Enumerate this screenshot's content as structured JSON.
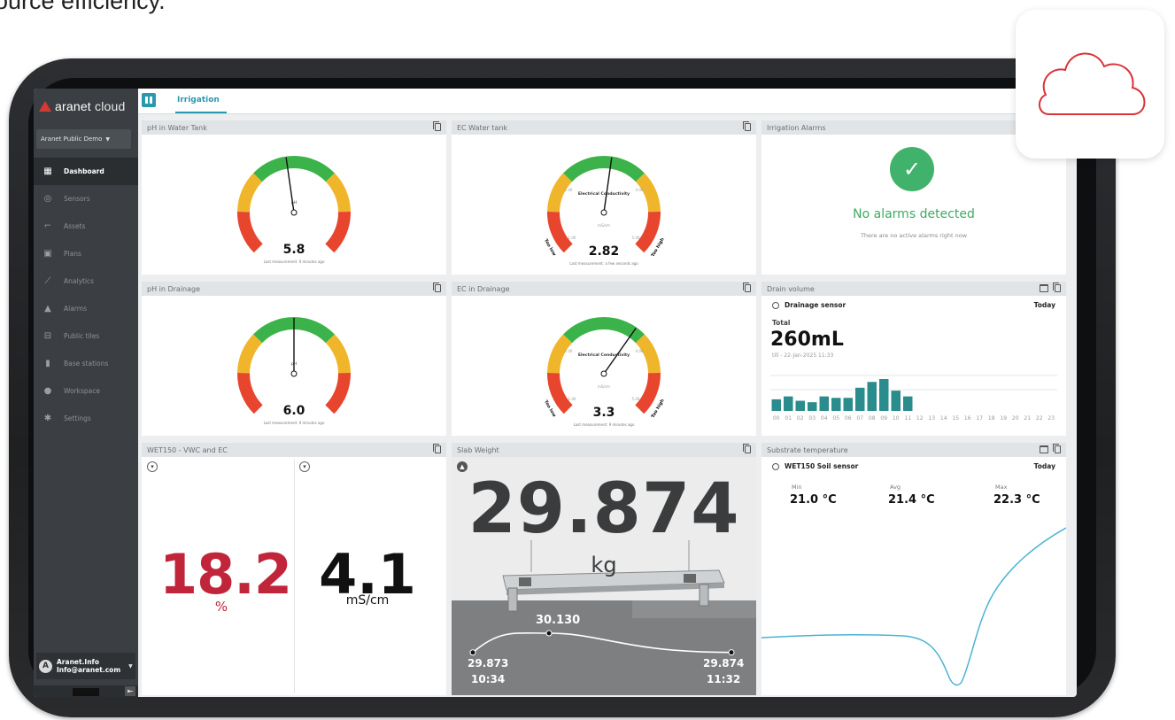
{
  "caption": "ource efficiency.",
  "app": {
    "logo_prefix": "aranet",
    "logo_suffix": "cloud",
    "workspace": "Aranet Public Demo",
    "nav": [
      {
        "label": "Dashboard",
        "icon": "dashboard-icon",
        "active": true
      },
      {
        "label": "Sensors",
        "icon": "sensor-icon",
        "active": false
      },
      {
        "label": "Assets",
        "icon": "asset-icon",
        "active": false
      },
      {
        "label": "Plans",
        "icon": "plan-icon",
        "active": false
      },
      {
        "label": "Analytics",
        "icon": "analytics-icon",
        "active": false
      },
      {
        "label": "Alarms",
        "icon": "alarm-icon",
        "active": false
      },
      {
        "label": "Public tiles",
        "icon": "public-tiles-icon",
        "active": false
      },
      {
        "label": "Base stations",
        "icon": "base-station-icon",
        "active": false
      },
      {
        "label": "Workspace",
        "icon": "workspace-icon",
        "active": false
      },
      {
        "label": "Settings",
        "icon": "gear-icon",
        "active": false
      }
    ],
    "user": {
      "initial": "A",
      "name": "Aranet.Info",
      "email": "Info@aranet.com"
    },
    "tab": "Irrigation"
  },
  "tiles": {
    "ph_tank": {
      "title": "pH in Water Tank",
      "center_label": "pH",
      "value": "5.8",
      "note": "Last measurement: 9 minutes ago",
      "needle_fraction": 0.47
    },
    "ec_tank": {
      "title": "EC Water tank",
      "center_label": "Electrical Conductivity",
      "unit_label": "mS/cm",
      "value": "2.82",
      "note": "Last measurement: a few seconds ago",
      "low_label": "Too low",
      "high_label": "Too high",
      "tick_left": "2.00",
      "tick_right": "4.00",
      "tick_bottom_left": "1.00",
      "tick_bottom_right": "5.00",
      "needle_fraction": 0.53
    },
    "alarms": {
      "title": "Irrigation Alarms",
      "headline": "No alarms detected",
      "subtitle": "There are no active alarms right now"
    },
    "ph_drain": {
      "title": "pH in Drainage",
      "center_label": "pH",
      "value": "6.0",
      "note": "Last measurement: 9 minutes ago",
      "needle_fraction": 0.5
    },
    "ec_drain": {
      "title": "EC in Drainage",
      "center_label": "Electrical Conductivity",
      "unit_label": "mS/cm",
      "value": "3.3",
      "note": "Last measurement: 9 minutes ago",
      "low_label": "Too low",
      "high_label": "Too high",
      "tick_left": "2.00",
      "tick_right": "4.00",
      "tick_bottom_left": "1.00",
      "tick_bottom_right": "5.00",
      "needle_fraction": 0.63
    },
    "drain_volume": {
      "title": "Drain volume",
      "sensor": "Drainage sensor",
      "period": "Today",
      "total_label": "Total",
      "total": "260mL",
      "till": "till - 22-Jan-2025 11:33"
    },
    "wet150": {
      "title": "WET150 - VWC and EC",
      "vwc_value": "18.2",
      "vwc_unit": "%",
      "ec_value": "4.1",
      "ec_unit": "mS/cm"
    },
    "slab": {
      "title": "Slab Weight",
      "value": "29.874",
      "unit": "kg",
      "peak": "30.130",
      "start_value": "29.873",
      "start_time": "10:34",
      "end_value": "29.874",
      "end_time": "11:32"
    },
    "substrate": {
      "title": "Substrate temperature",
      "sensor": "WET150 Soil sensor",
      "period": "Today",
      "min_label": "Min",
      "min": "21.0 °C",
      "avg_label": "Avg",
      "avg": "21.4 °C",
      "max_label": "Max",
      "max": "22.3 °C"
    }
  },
  "chart_data": [
    {
      "type": "bar",
      "title": "Drain volume",
      "categories": [
        "00",
        "01",
        "02",
        "03",
        "04",
        "05",
        "06",
        "07",
        "08",
        "09",
        "10",
        "11",
        "12",
        "13",
        "14",
        "15",
        "16",
        "17",
        "18",
        "19",
        "20",
        "21",
        "22",
        "23"
      ],
      "values": [
        8,
        10,
        7,
        6,
        10,
        9,
        9,
        16,
        20,
        22,
        14,
        10,
        0,
        0,
        0,
        0,
        0,
        0,
        0,
        0,
        0,
        0,
        0,
        0
      ]
    },
    {
      "type": "line",
      "title": "Slab Weight",
      "x": [
        "10:34",
        "",
        "11:32"
      ],
      "values": [
        29.873,
        30.13,
        29.874
      ]
    }
  ],
  "colors": {
    "accent": "#2a98ad",
    "gauge_red": "#e8452f",
    "gauge_yellow": "#f0b62b",
    "gauge_green": "#3cb34a",
    "vwc_red": "#c0253a",
    "bar_teal": "#2a8c8c",
    "ok_green": "#41b26b"
  }
}
